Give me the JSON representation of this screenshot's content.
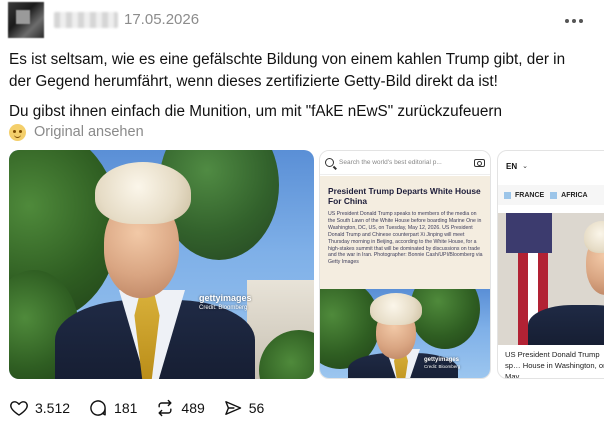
{
  "post": {
    "timestamp": "17.05.2026",
    "text_line1": "Es ist seltsam, wie es eine gefälschte Bildung von einem kahlen Trump gibt, der in der Gegend herumfährt, wenn dieses zertifizierte Getty-Bild direkt da ist!",
    "text_line2": "Du gibst ihnen einfach die Munition, um mit \"fAkE nEwS\" zurückzufeuern",
    "translate_label": "Original ansehen"
  },
  "media": {
    "image1_watermark": "gettyimages",
    "image1_credit": "Credit: Bloomberg",
    "image2": {
      "search_placeholder": "Search the world's best editorial p...",
      "title": "President Trump Departs White House For China",
      "body": "US President Donald Trump speaks to members of the media on the South Lawn of the White House before boarding Marine One in Washington, DC, US, on Tuesday, May 12, 2026. US President Donald Trump and Chinese counterpart Xi Jinping will meet Thursday morning in Beijing, according to the White House, for a high-stakes summit that will be dominated by discussions on trade and the war in Iran. Photographer: Bonnie Cash/UPI/Bloomberg via Getty Images",
      "watermark": "gettyimages",
      "credit": "Credit: Bloomberg"
    },
    "image3": {
      "language": "EN",
      "chevron": "⌄",
      "tags": [
        "FRANCE",
        "AFRICA"
      ],
      "caption": "US President Donald Trump sp… House in Washington, on May"
    }
  },
  "actions": {
    "likes": "3.512",
    "comments": "181",
    "reposts": "489",
    "shares": "56"
  },
  "icons": [
    "more-horizontal-icon",
    "translate-emoji-icon",
    "search-icon",
    "camera-icon",
    "heart-icon",
    "comment-icon",
    "repost-icon",
    "share-icon"
  ]
}
